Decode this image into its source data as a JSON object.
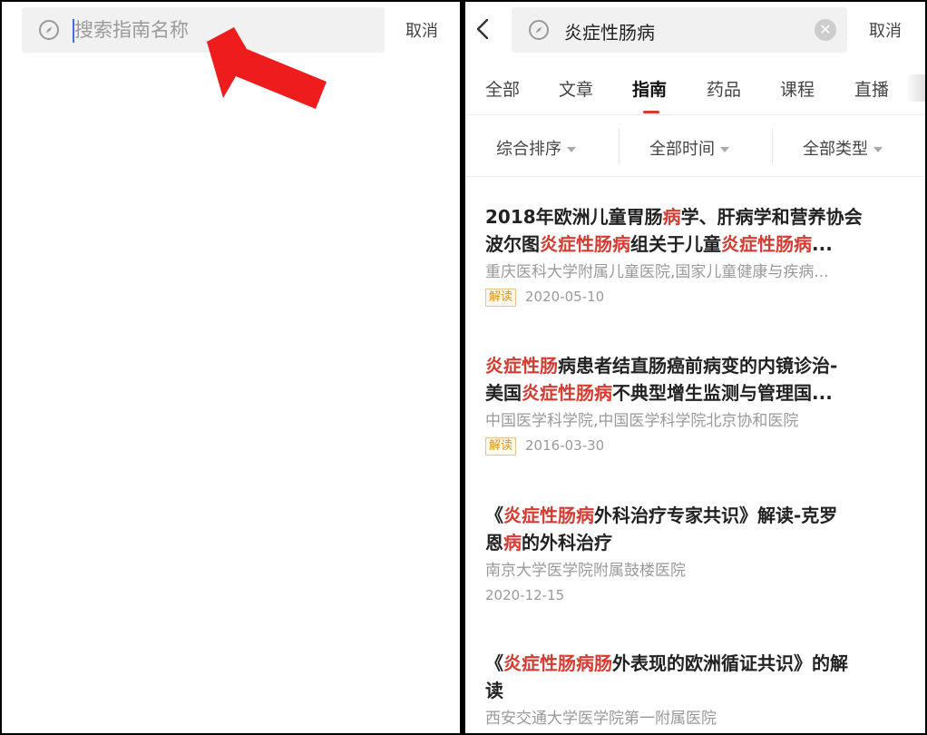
{
  "left_screen": {
    "search": {
      "placeholder": "搜索指南名称"
    },
    "cancel_label": "取消"
  },
  "right_screen": {
    "search": {
      "query": "炎症性肠病"
    },
    "cancel_label": "取消",
    "tabs": [
      {
        "label": "全部"
      },
      {
        "label": "文章"
      },
      {
        "label": "指南",
        "active": true
      },
      {
        "label": "药品"
      },
      {
        "label": "课程"
      },
      {
        "label": "直播"
      }
    ],
    "filters": [
      {
        "label": "综合排序"
      },
      {
        "label": "全部时间"
      },
      {
        "label": "全部类型"
      }
    ],
    "results": [
      {
        "title_line1": [
          {
            "t": "2018年欧洲儿童胃肠"
          },
          {
            "t": "病",
            "hl": true
          },
          {
            "t": "学、肝病学和营养协会"
          }
        ],
        "title_line2": [
          {
            "t": "波尔图"
          },
          {
            "t": "炎症性肠病",
            "hl": true
          },
          {
            "t": "组关于儿童"
          },
          {
            "t": "炎症性肠病",
            "hl": true
          },
          {
            "t": "..."
          }
        ],
        "org": "重庆医科大学附属儿童医院,国家儿童健康与疾病...",
        "badge": "解读",
        "date": "2020-05-10"
      },
      {
        "title_line1": [
          {
            "t": "炎症性肠",
            "hl": true
          },
          {
            "t": "病患者结直肠癌前病变的内镜诊治-"
          }
        ],
        "title_line2": [
          {
            "t": "美国"
          },
          {
            "t": "炎症性肠病",
            "hl": true
          },
          {
            "t": "不典型增生监测与管理国..."
          }
        ],
        "org": "中国医学科学院,中国医学科学院北京协和医院",
        "badge": "解读",
        "date": "2016-03-30"
      },
      {
        "title_line1": [
          {
            "t": "《"
          },
          {
            "t": "炎症性肠病",
            "hl": true
          },
          {
            "t": "外科治疗专家共识》解读-克罗"
          }
        ],
        "title_line2": [
          {
            "t": "恩"
          },
          {
            "t": "病",
            "hl": true
          },
          {
            "t": "的外科治疗"
          }
        ],
        "org": "南京大学医学院附属鼓楼医院",
        "badge": "",
        "date": "2020-12-15"
      },
      {
        "title_line1": [
          {
            "t": "《"
          },
          {
            "t": "炎症性肠病肠",
            "hl": true
          },
          {
            "t": "外表现的欧洲循证共识》的解"
          }
        ],
        "title_line2": [
          {
            "t": "读"
          }
        ],
        "org": "西安交通大学医学院第一附属医院",
        "badge": "",
        "date": ""
      }
    ]
  },
  "colors": {
    "accent": "#d63b32",
    "arrow": "#ee1c1c",
    "badge": "#d8941e"
  }
}
